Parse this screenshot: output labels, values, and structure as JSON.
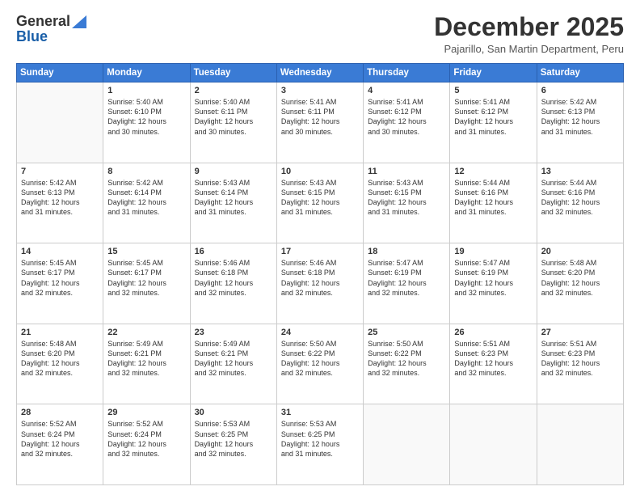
{
  "logo": {
    "line1": "General",
    "line2": "Blue"
  },
  "header": {
    "month": "December 2025",
    "location": "Pajarillo, San Martin Department, Peru"
  },
  "weekdays": [
    "Sunday",
    "Monday",
    "Tuesday",
    "Wednesday",
    "Thursday",
    "Friday",
    "Saturday"
  ],
  "weeks": [
    [
      {
        "day": "",
        "sunrise": "",
        "sunset": "",
        "daylight": ""
      },
      {
        "day": "1",
        "sunrise": "Sunrise: 5:40 AM",
        "sunset": "Sunset: 6:10 PM",
        "daylight": "Daylight: 12 hours and 30 minutes."
      },
      {
        "day": "2",
        "sunrise": "Sunrise: 5:40 AM",
        "sunset": "Sunset: 6:11 PM",
        "daylight": "Daylight: 12 hours and 30 minutes."
      },
      {
        "day": "3",
        "sunrise": "Sunrise: 5:41 AM",
        "sunset": "Sunset: 6:11 PM",
        "daylight": "Daylight: 12 hours and 30 minutes."
      },
      {
        "day": "4",
        "sunrise": "Sunrise: 5:41 AM",
        "sunset": "Sunset: 6:12 PM",
        "daylight": "Daylight: 12 hours and 30 minutes."
      },
      {
        "day": "5",
        "sunrise": "Sunrise: 5:41 AM",
        "sunset": "Sunset: 6:12 PM",
        "daylight": "Daylight: 12 hours and 31 minutes."
      },
      {
        "day": "6",
        "sunrise": "Sunrise: 5:42 AM",
        "sunset": "Sunset: 6:13 PM",
        "daylight": "Daylight: 12 hours and 31 minutes."
      }
    ],
    [
      {
        "day": "7",
        "sunrise": "Sunrise: 5:42 AM",
        "sunset": "Sunset: 6:13 PM",
        "daylight": "Daylight: 12 hours and 31 minutes."
      },
      {
        "day": "8",
        "sunrise": "Sunrise: 5:42 AM",
        "sunset": "Sunset: 6:14 PM",
        "daylight": "Daylight: 12 hours and 31 minutes."
      },
      {
        "day": "9",
        "sunrise": "Sunrise: 5:43 AM",
        "sunset": "Sunset: 6:14 PM",
        "daylight": "Daylight: 12 hours and 31 minutes."
      },
      {
        "day": "10",
        "sunrise": "Sunrise: 5:43 AM",
        "sunset": "Sunset: 6:15 PM",
        "daylight": "Daylight: 12 hours and 31 minutes."
      },
      {
        "day": "11",
        "sunrise": "Sunrise: 5:43 AM",
        "sunset": "Sunset: 6:15 PM",
        "daylight": "Daylight: 12 hours and 31 minutes."
      },
      {
        "day": "12",
        "sunrise": "Sunrise: 5:44 AM",
        "sunset": "Sunset: 6:16 PM",
        "daylight": "Daylight: 12 hours and 31 minutes."
      },
      {
        "day": "13",
        "sunrise": "Sunrise: 5:44 AM",
        "sunset": "Sunset: 6:16 PM",
        "daylight": "Daylight: 12 hours and 32 minutes."
      }
    ],
    [
      {
        "day": "14",
        "sunrise": "Sunrise: 5:45 AM",
        "sunset": "Sunset: 6:17 PM",
        "daylight": "Daylight: 12 hours and 32 minutes."
      },
      {
        "day": "15",
        "sunrise": "Sunrise: 5:45 AM",
        "sunset": "Sunset: 6:17 PM",
        "daylight": "Daylight: 12 hours and 32 minutes."
      },
      {
        "day": "16",
        "sunrise": "Sunrise: 5:46 AM",
        "sunset": "Sunset: 6:18 PM",
        "daylight": "Daylight: 12 hours and 32 minutes."
      },
      {
        "day": "17",
        "sunrise": "Sunrise: 5:46 AM",
        "sunset": "Sunset: 6:18 PM",
        "daylight": "Daylight: 12 hours and 32 minutes."
      },
      {
        "day": "18",
        "sunrise": "Sunrise: 5:47 AM",
        "sunset": "Sunset: 6:19 PM",
        "daylight": "Daylight: 12 hours and 32 minutes."
      },
      {
        "day": "19",
        "sunrise": "Sunrise: 5:47 AM",
        "sunset": "Sunset: 6:19 PM",
        "daylight": "Daylight: 12 hours and 32 minutes."
      },
      {
        "day": "20",
        "sunrise": "Sunrise: 5:48 AM",
        "sunset": "Sunset: 6:20 PM",
        "daylight": "Daylight: 12 hours and 32 minutes."
      }
    ],
    [
      {
        "day": "21",
        "sunrise": "Sunrise: 5:48 AM",
        "sunset": "Sunset: 6:20 PM",
        "daylight": "Daylight: 12 hours and 32 minutes."
      },
      {
        "day": "22",
        "sunrise": "Sunrise: 5:49 AM",
        "sunset": "Sunset: 6:21 PM",
        "daylight": "Daylight: 12 hours and 32 minutes."
      },
      {
        "day": "23",
        "sunrise": "Sunrise: 5:49 AM",
        "sunset": "Sunset: 6:21 PM",
        "daylight": "Daylight: 12 hours and 32 minutes."
      },
      {
        "day": "24",
        "sunrise": "Sunrise: 5:50 AM",
        "sunset": "Sunset: 6:22 PM",
        "daylight": "Daylight: 12 hours and 32 minutes."
      },
      {
        "day": "25",
        "sunrise": "Sunrise: 5:50 AM",
        "sunset": "Sunset: 6:22 PM",
        "daylight": "Daylight: 12 hours and 32 minutes."
      },
      {
        "day": "26",
        "sunrise": "Sunrise: 5:51 AM",
        "sunset": "Sunset: 6:23 PM",
        "daylight": "Daylight: 12 hours and 32 minutes."
      },
      {
        "day": "27",
        "sunrise": "Sunrise: 5:51 AM",
        "sunset": "Sunset: 6:23 PM",
        "daylight": "Daylight: 12 hours and 32 minutes."
      }
    ],
    [
      {
        "day": "28",
        "sunrise": "Sunrise: 5:52 AM",
        "sunset": "Sunset: 6:24 PM",
        "daylight": "Daylight: 12 hours and 32 minutes."
      },
      {
        "day": "29",
        "sunrise": "Sunrise: 5:52 AM",
        "sunset": "Sunset: 6:24 PM",
        "daylight": "Daylight: 12 hours and 32 minutes."
      },
      {
        "day": "30",
        "sunrise": "Sunrise: 5:53 AM",
        "sunset": "Sunset: 6:25 PM",
        "daylight": "Daylight: 12 hours and 32 minutes."
      },
      {
        "day": "31",
        "sunrise": "Sunrise: 5:53 AM",
        "sunset": "Sunset: 6:25 PM",
        "daylight": "Daylight: 12 hours and 31 minutes."
      },
      {
        "day": "",
        "sunrise": "",
        "sunset": "",
        "daylight": ""
      },
      {
        "day": "",
        "sunrise": "",
        "sunset": "",
        "daylight": ""
      },
      {
        "day": "",
        "sunrise": "",
        "sunset": "",
        "daylight": ""
      }
    ]
  ]
}
